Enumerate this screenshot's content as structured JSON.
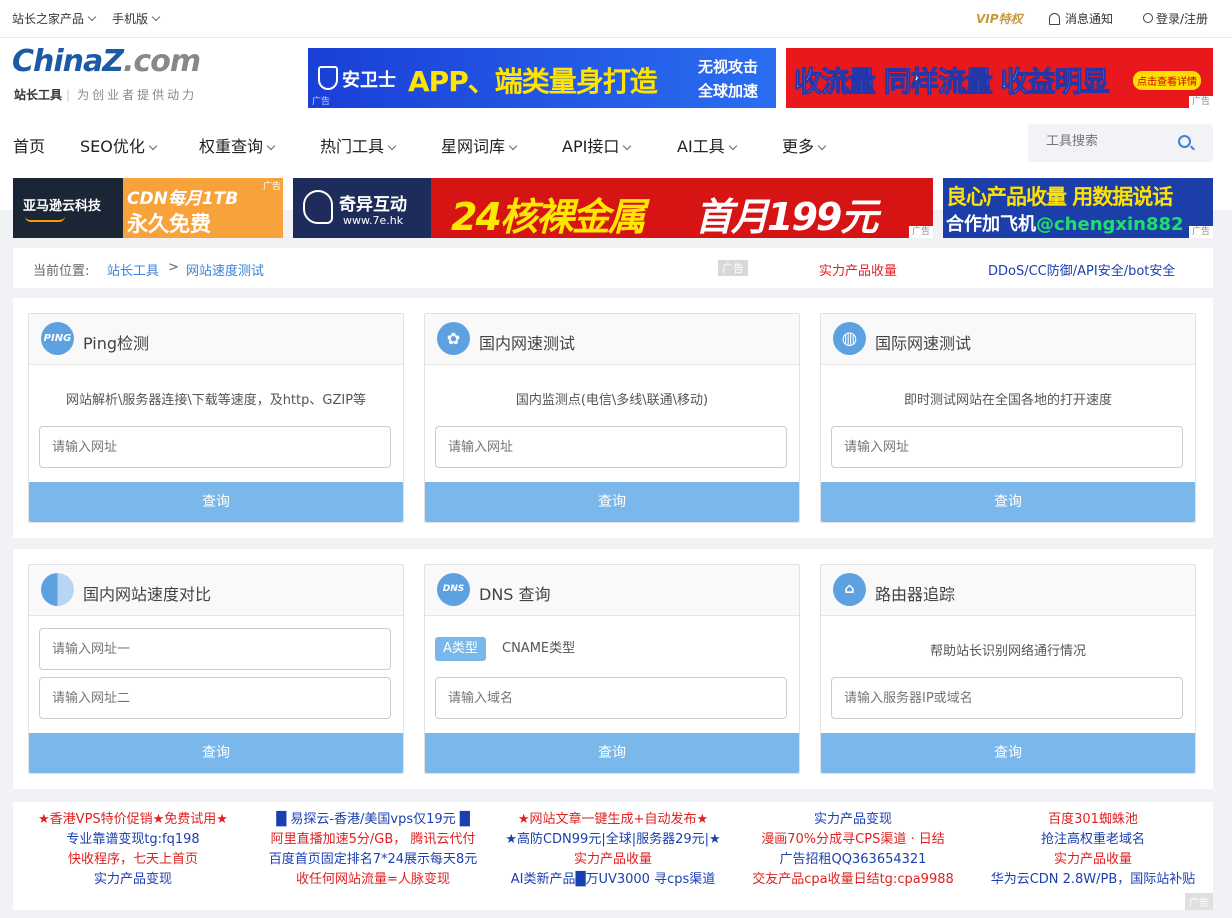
{
  "topbar": {
    "products": "站长之家产品",
    "mobile": "手机版",
    "vip": "VIP特权",
    "notify": "消息通知",
    "login": "登录/注册"
  },
  "logo": {
    "main_a": "China",
    "main_b": "Z",
    "main_c": ".com",
    "sub_a": "站长工具",
    "sub_b": "为创业者提供动力"
  },
  "banners": {
    "b1_brand": "安卫士",
    "b1_text": "APP、端类量身打造",
    "b1_side1": "无视攻击",
    "b1_side2": "全球加速",
    "b2_text": "收流量 同样流量 收益明显",
    "b2_btn": "点击查看详情",
    "b3_brand": "亚马逊云科技",
    "b3_l1": "CDN每月1TB",
    "b3_l2": "永久免费",
    "b4_brand": "奇异互动",
    "b4_url": "www.7e.hk",
    "b4_text1": "24核裸金属",
    "b4_text2": "首月199元",
    "b5_l1": "良心产品收量 用数据说话",
    "b5_l2a": "合作加飞机",
    "b5_l2b": "@chengxin882",
    "ad": "广告"
  },
  "nav": {
    "items": [
      "首页",
      "SEO优化",
      "权重查询",
      "热门工具",
      "星网词库",
      "API接口",
      "AI工具",
      "更多"
    ]
  },
  "search": {
    "placeholder": "工具搜索"
  },
  "crumb": {
    "label": "当前位置:",
    "home": "站长工具",
    "sep": ">",
    "current": "网站速度测试",
    "ad": "广告",
    "ad1": "实力产品收量",
    "ad2": "DDoS/CC防御/API安全/bot安全"
  },
  "cards": {
    "ping": {
      "icon": "PING",
      "title": "Ping检测",
      "desc": "网站解析\\服务器连接\\下载等速度，及http、GZIP等",
      "ph": "请输入网址",
      "btn": "查询"
    },
    "domestic": {
      "title": "国内网速测试",
      "desc": "国内监测点(电信\\多线\\联通\\移动)",
      "ph": "请输入网址",
      "btn": "查询"
    },
    "intl": {
      "title": "国际网速测试",
      "desc": "即时测试网站在全国各地的打开速度",
      "ph": "请输入网址",
      "btn": "查询"
    },
    "compare": {
      "title": "国内网站速度对比",
      "ph1": "请输入网址一",
      "ph2": "请输入网址二",
      "btn": "查询"
    },
    "dns": {
      "icon": "DNS",
      "title": "DNS 查询",
      "tag_a": "A类型",
      "tag_cname": "CNAME类型",
      "ph": "请输入域名",
      "btn": "查询"
    },
    "trace": {
      "title": "路由器追踪",
      "desc": "帮助站长识别网络通行情况",
      "ph": "请输入服务器IP或域名",
      "btn": "查询"
    }
  },
  "links": {
    "col1": [
      "★香港VPS特价促销★免费试用★",
      "专业靠谱变现tg:fq198",
      "快收程序，七天上首页",
      "实力产品变现"
    ],
    "col2": [
      "█ 易探云-香港/美国vps仅19元 █",
      "阿里直播加速5分/GB， 腾讯云代付",
      "百度首页固定排名7*24展示每天8元",
      "收任何网站流量=人脉变现"
    ],
    "col3": [
      "★网站文章一键生成+自动发布★",
      "★高防CDN99元|全球|服务器29元|★",
      "实力产品收量",
      "AI类新产品█万UV3000 寻cps渠道"
    ],
    "col4": [
      "实力产品变现",
      "漫画70%分成寻CPS渠道 · 日结",
      "广告招租QQ363654321",
      "交友产品cpa收量日结tg:cpa9988"
    ],
    "col5": [
      "百度301蜘蛛池",
      "抢注高权重老域名",
      "实力产品收量",
      "华为云CDN 2.8W/PB，国际站补贴"
    ],
    "ad": "广告"
  },
  "colors": {
    "accent": "#3a84d9",
    "button": "#7ab7ea",
    "red": "#e02020",
    "blue": "#1a3fb0"
  }
}
